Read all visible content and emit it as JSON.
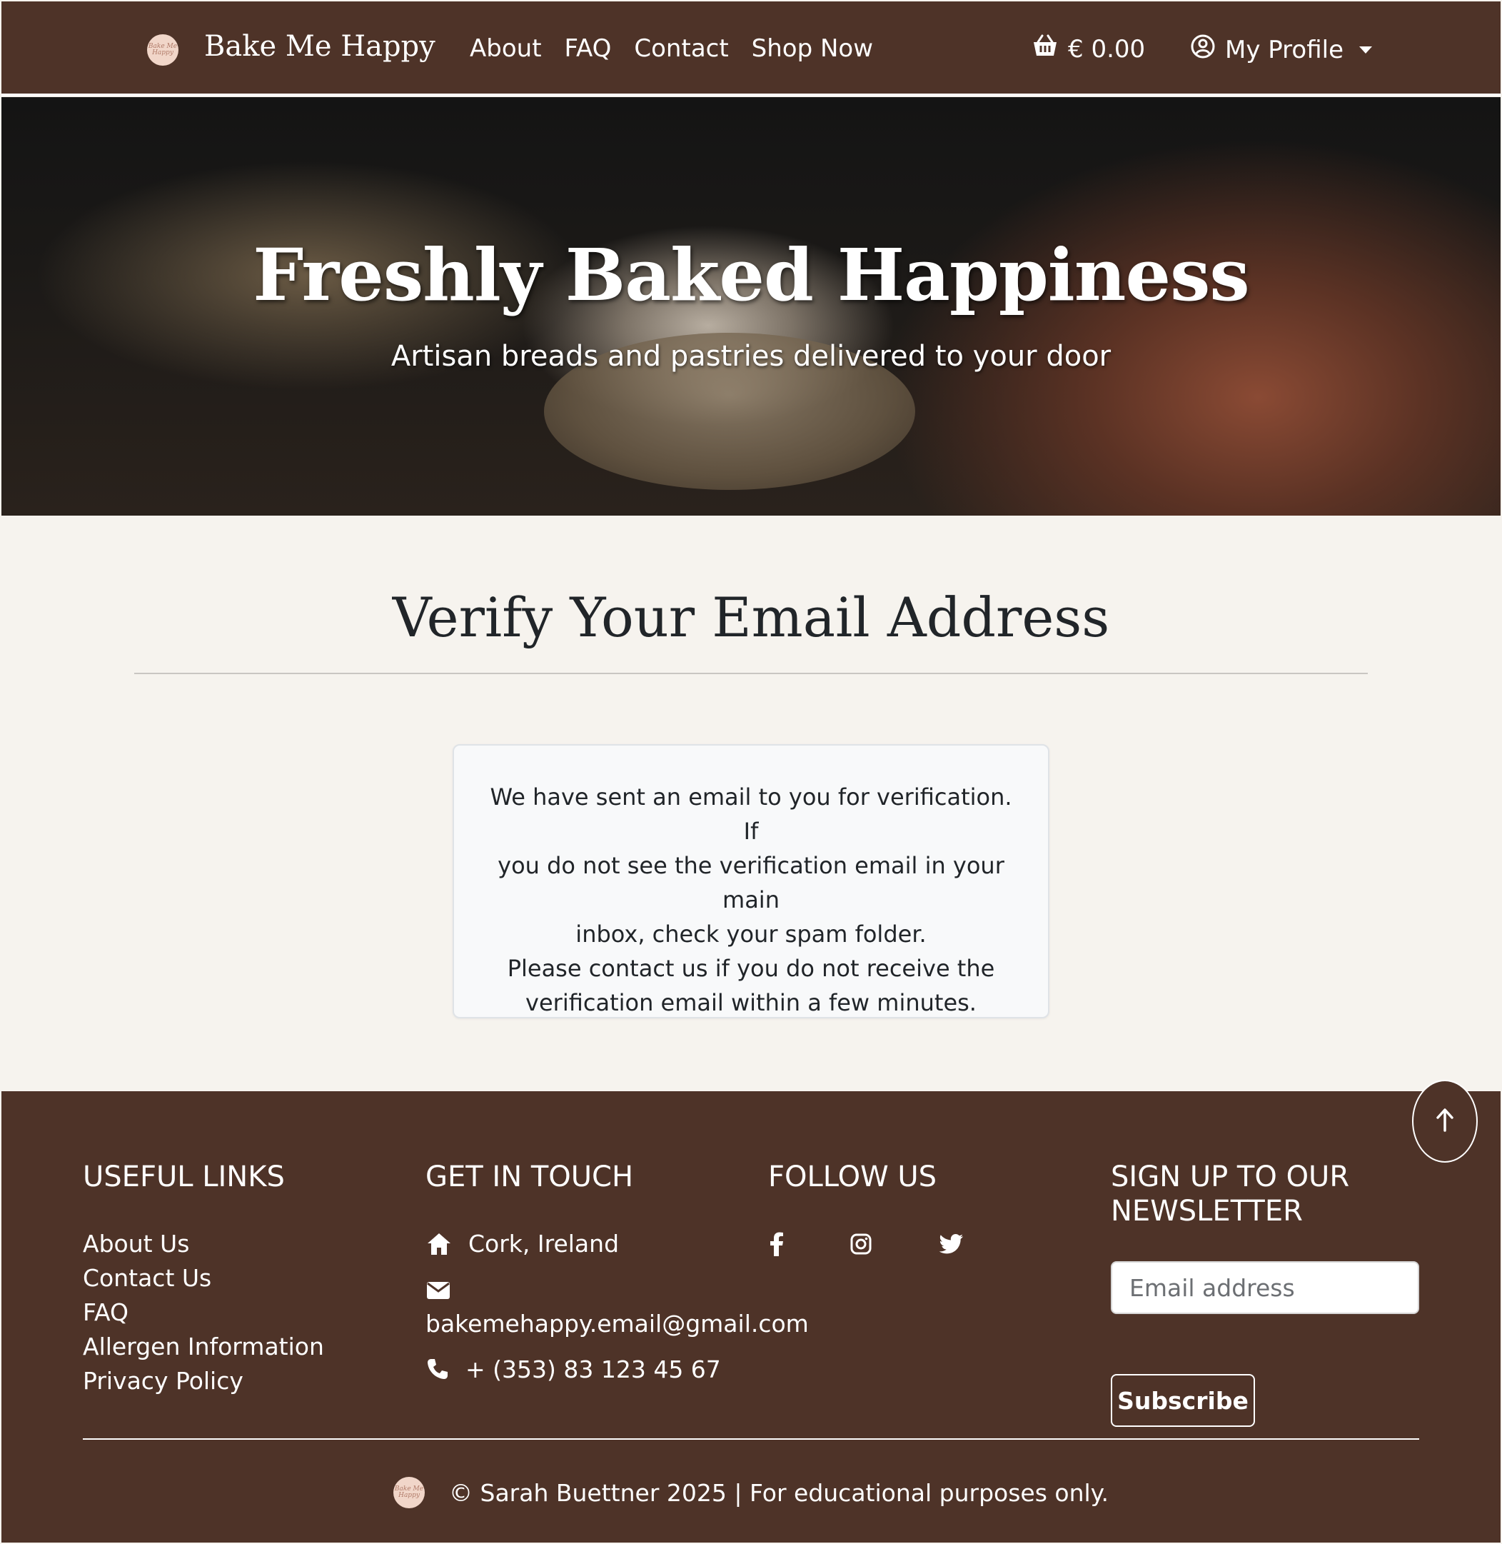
{
  "navbar": {
    "brand": "Bake Me Happy",
    "logo_text": "Bake Me Happy",
    "links": [
      "About",
      "FAQ",
      "Contact",
      "Shop Now"
    ],
    "cart_total": "€ 0.00",
    "profile_label": "My Profile"
  },
  "hero": {
    "title": "Freshly Baked Happiness",
    "subtitle": "Artisan breads and pastries delivered to your door"
  },
  "main": {
    "title": "Verify Your Email Address",
    "message_lines": [
      "We have sent an email to you for verification. If",
      "you do not see the verification email in your main",
      "inbox, check your spam folder.",
      "Please contact us if you do not receive the",
      "verification email within a few minutes."
    ]
  },
  "footer": {
    "useful_links": {
      "heading": "USEFUL LINKS",
      "items": [
        "About Us",
        "Contact Us",
        "FAQ",
        "Allergen Information",
        "Privacy Policy"
      ]
    },
    "get_in_touch": {
      "heading": "GET IN TOUCH",
      "location": "Cork, Ireland",
      "email": "bakemehappy.email@gmail.com",
      "phone": "+ (353) 83 123 45 67"
    },
    "follow_us": {
      "heading": "FOLLOW US",
      "icons": [
        "facebook-icon",
        "instagram-icon",
        "twitter-icon"
      ]
    },
    "newsletter": {
      "heading_line1": "SIGN UP TO OUR",
      "heading_line2": "NEWSLETTER",
      "placeholder": "Email address",
      "button": "Subscribe"
    },
    "copyright": "© Sarah Buettner 2025 | For educational purposes only."
  },
  "colors": {
    "brand_brown": "#4e3328",
    "page_bg": "#f6f3ee",
    "card_bg": "#f8f9fa"
  }
}
